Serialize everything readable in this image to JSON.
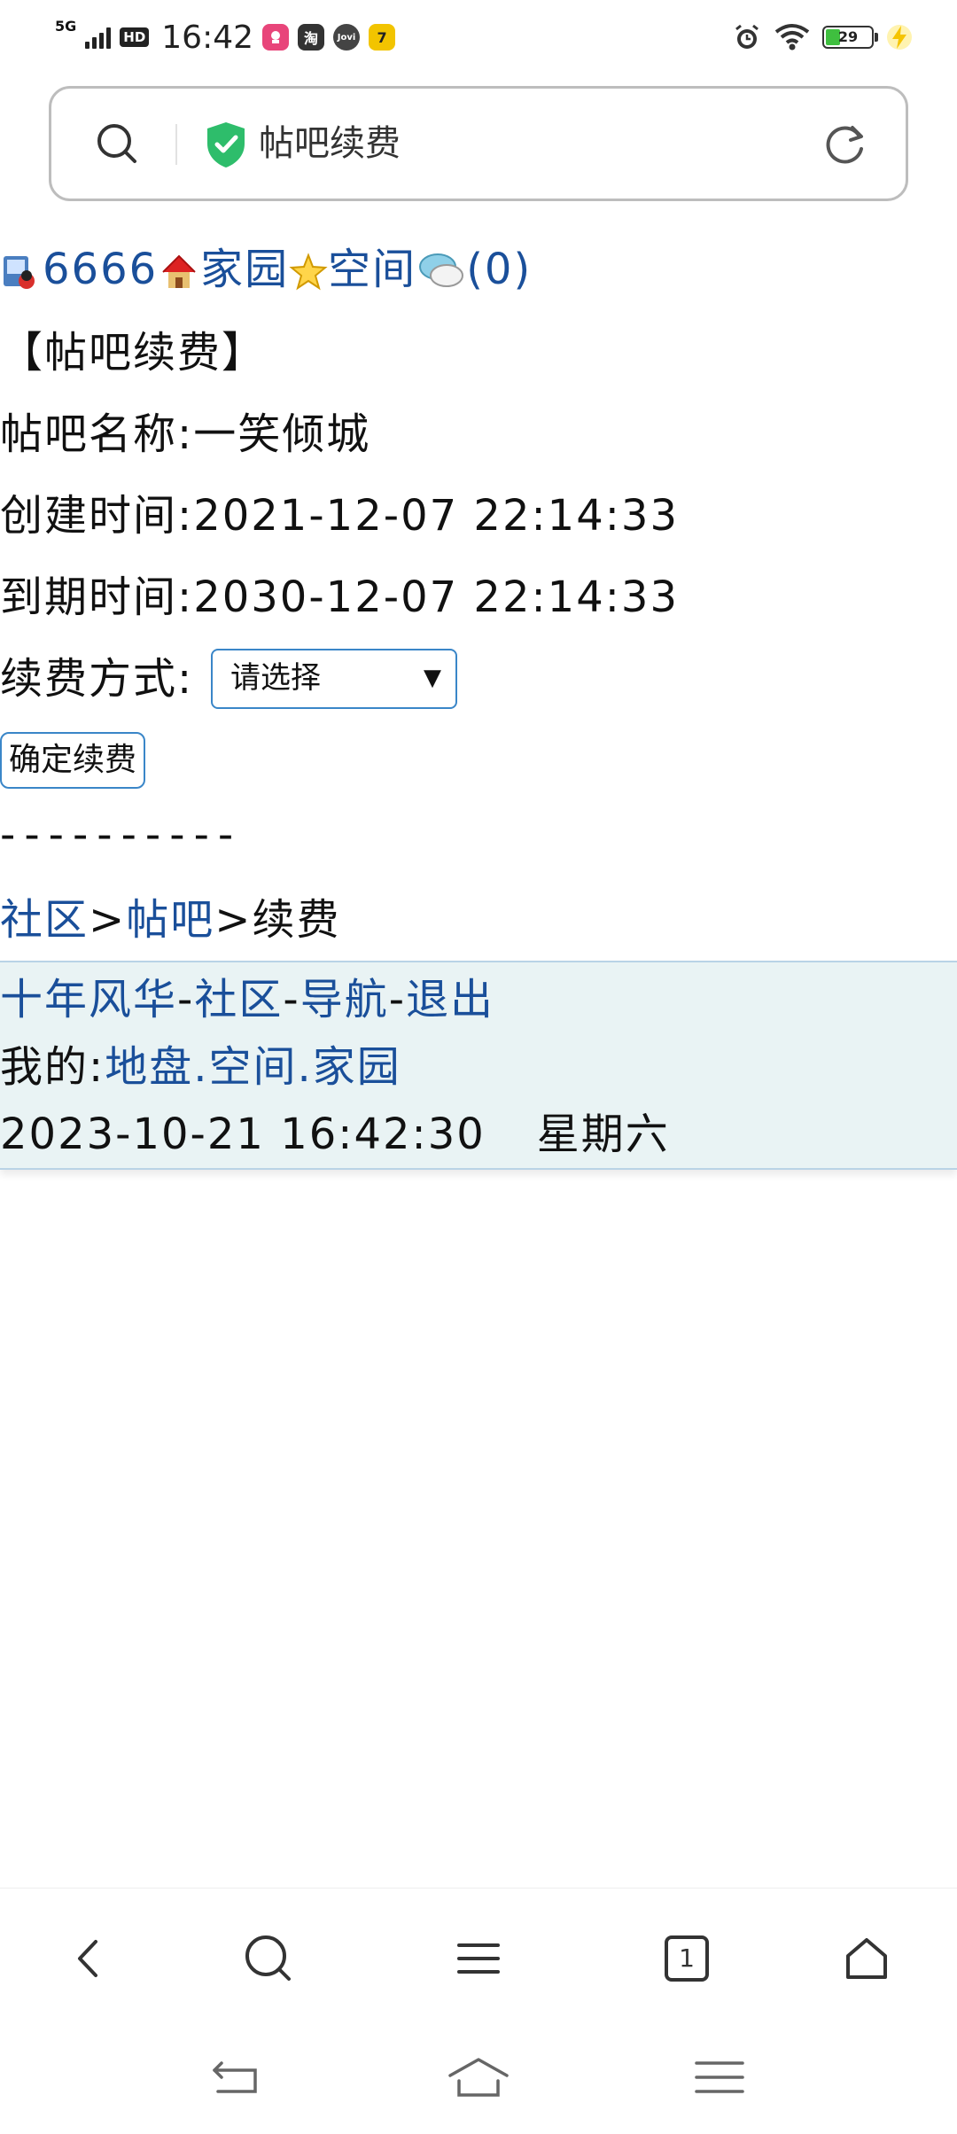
{
  "status_bar": {
    "network": "5G",
    "hd": "HD",
    "time": "16:42",
    "battery": "29",
    "apps": [
      {
        "icon": "app-icon-red",
        "color": "#e8457a"
      },
      {
        "icon": "taobao-icon",
        "glyph": "淘",
        "color": "#333333"
      },
      {
        "icon": "jovi-icon",
        "glyph": "Jovi",
        "color": "#444444"
      },
      {
        "icon": "app-icon-yellow",
        "glyph": "7",
        "color": "#f2c400"
      }
    ]
  },
  "address_bar": {
    "title": "帖吧续费"
  },
  "page": {
    "top_nav": {
      "user": "6666",
      "home": "家园",
      "space": "空间",
      "messages": "(0)"
    },
    "heading": "【帖吧续费】",
    "info": {
      "name_label": "帖吧名称:",
      "name_value": "一笑倾城",
      "created_label": "创建时间:",
      "created_value": "2021-12-07 22:14:33",
      "expires_label": "到期时间:",
      "expires_value": "2030-12-07 22:14:33",
      "method_label": "续费方式:",
      "method_select": "请选择"
    },
    "confirm_button": "确定续费",
    "divider": "----------",
    "breadcrumb": {
      "community": "社区",
      "sep1": ">",
      "tieba": "帖吧",
      "sep2": ">",
      "current": "续费"
    },
    "footer": {
      "site": "十年风华",
      "dash1": "-",
      "community": "社区",
      "dash2": "-",
      "nav": "导航",
      "dash3": "-",
      "logout": "退出",
      "mine_label": "我的:",
      "territory": "地盘",
      "dot1": ".",
      "space": "空间",
      "dot2": ".",
      "home": "家园",
      "datetime": "2023-10-21 16:42:30",
      "weekday": "星期六"
    }
  },
  "bottom_nav": {
    "tab_count": "1"
  },
  "colors": {
    "link": "#1a4f9a",
    "border_blue": "#3a86c8",
    "footer_bg": "#e9f3f4",
    "shield_green": "#2ebd6b"
  }
}
